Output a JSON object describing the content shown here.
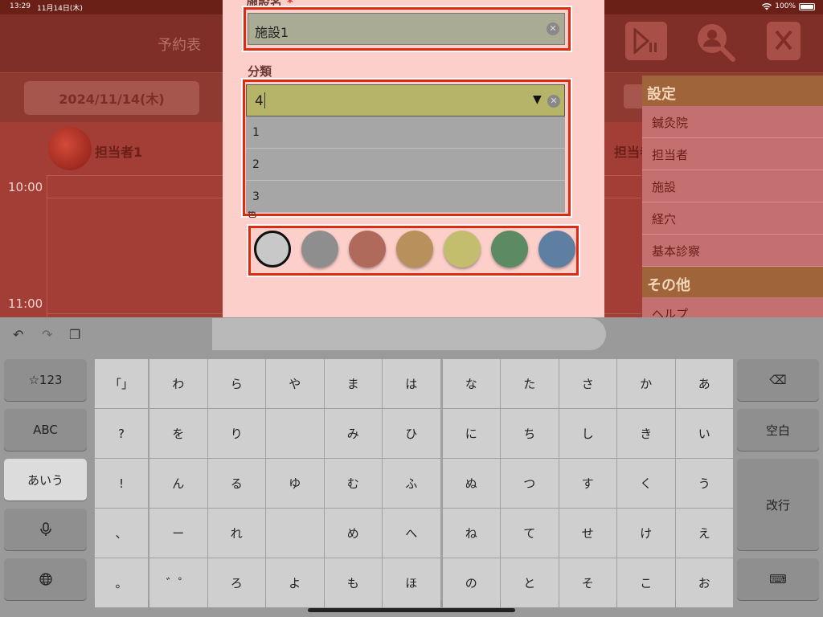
{
  "status_bar": {
    "time": "13:29",
    "date": "11月14日(木)",
    "battery": "100%"
  },
  "app": {
    "title": "予約表",
    "date_button": "2024/11/14(木)",
    "staff": [
      "担当者1",
      "担当者"
    ],
    "times": [
      "10:00",
      "11:00"
    ]
  },
  "side_menu": {
    "settings_header": "設定",
    "settings_items": [
      "鍼灸院",
      "担当者",
      "施設",
      "経穴",
      "基本診察"
    ],
    "other_header": "その他",
    "other_items": [
      "ヘルプ"
    ]
  },
  "modal": {
    "facility_label": "施設名",
    "required_mark": "*",
    "facility_value": "施設1",
    "category_label": "分類",
    "category_value": "4",
    "category_options": [
      "1",
      "2",
      "3"
    ],
    "color_label": "色",
    "colors": [
      "#c8c8c8",
      "#8e8e8e",
      "#b06a5c",
      "#b8905c",
      "#c2be6e",
      "#5c8a62",
      "#5e7ea2"
    ],
    "selected_color_index": 0
  },
  "keyboard": {
    "left_keys": [
      "☆123",
      "ABC",
      "あいう",
      "🎤",
      "🌐"
    ],
    "punct_keys": [
      "「」",
      "?",
      "!",
      "、",
      "。"
    ],
    "columns": [
      [
        "わ",
        "を",
        "ん",
        "ー",
        "゛゜"
      ],
      [
        "ら",
        "り",
        "る",
        "れ",
        "ろ"
      ],
      [
        "や",
        "",
        "ゆ",
        "",
        "よ"
      ],
      [
        "ま",
        "み",
        "む",
        "め",
        "も"
      ],
      [
        "は",
        "ひ",
        "ふ",
        "へ",
        "ほ"
      ],
      [
        "な",
        "に",
        "ぬ",
        "ね",
        "の"
      ],
      [
        "た",
        "ち",
        "つ",
        "て",
        "と"
      ],
      [
        "さ",
        "し",
        "す",
        "せ",
        "そ"
      ],
      [
        "か",
        "き",
        "く",
        "け",
        "こ"
      ],
      [
        "あ",
        "い",
        "う",
        "え",
        "お"
      ]
    ],
    "delete_label": "⌫",
    "space_label": "空白",
    "return_label": "改行",
    "hide_label": "⌨"
  }
}
